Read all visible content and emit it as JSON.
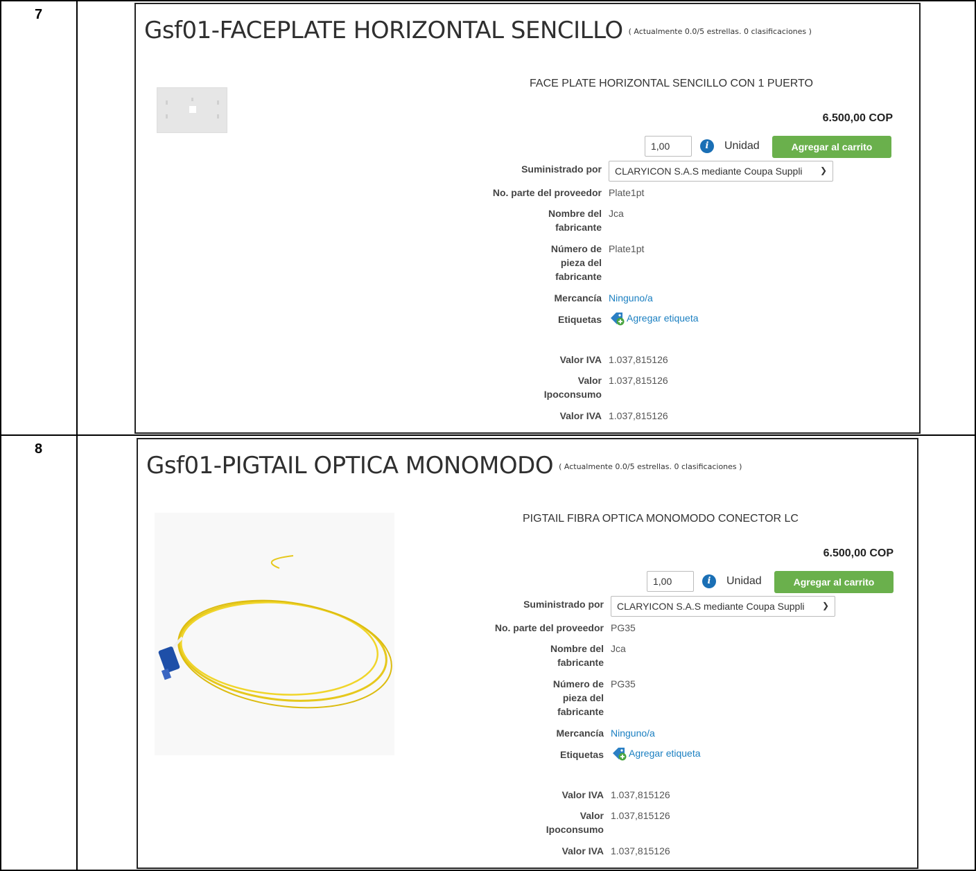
{
  "rows": [
    {
      "number": "7",
      "product": {
        "title": "Gsf01-FACEPLATE HORIZONTAL SENCILLO",
        "rating": "( Actualmente 0.0/5 estrellas. 0 clasificaciones )",
        "description": "FACE PLATE HORIZONTAL SENCILLO CON 1 PUERTO",
        "price": "6.500,00 COP",
        "quantity": "1,00",
        "unit": "Unidad",
        "add_to_cart": "Agregar al carrito",
        "supplied_by_label": "Suministrado por",
        "supplier": "CLARYICON S.A.S mediante Coupa Suppli",
        "supplier_part_label": "No. parte del proveedor",
        "supplier_part": "Plate1pt",
        "manufacturer_label_1": "Nombre del",
        "manufacturer_label_2": "fabricante",
        "manufacturer": "Jca",
        "mfr_part_label_1": "Número de",
        "mfr_part_label_2": "pieza del",
        "mfr_part_label_3": "fabricante",
        "mfr_part": "Plate1pt",
        "commodity_label": "Mercancía",
        "commodity": "Ninguno/a",
        "tags_label": "Etiquetas",
        "add_tag": "Agregar etiqueta",
        "iva_label": "Valor IVA",
        "iva": "1.037,815126",
        "ipoconsumo_label_1": "Valor",
        "ipoconsumo_label_2": "Ipoconsumo",
        "ipoconsumo": "1.037,815126",
        "iva2_label": "Valor IVA",
        "iva2": "1.037,815126"
      }
    },
    {
      "number": "8",
      "product": {
        "title": "Gsf01-PIGTAIL OPTICA MONOMODO",
        "rating": "( Actualmente 0.0/5 estrellas. 0 clasificaciones )",
        "description": "PIGTAIL FIBRA OPTICA MONOMODO CONECTOR LC",
        "price": "6.500,00 COP",
        "quantity": "1,00",
        "unit": "Unidad",
        "add_to_cart": "Agregar al carrito",
        "supplied_by_label": "Suministrado por",
        "supplier": "CLARYICON S.A.S mediante Coupa Suppli",
        "supplier_part_label": "No. parte del proveedor",
        "supplier_part": "PG35",
        "manufacturer_label_1": "Nombre del",
        "manufacturer_label_2": "fabricante",
        "manufacturer": "Jca",
        "mfr_part_label_1": "Número de",
        "mfr_part_label_2": "pieza del",
        "mfr_part_label_3": "fabricante",
        "mfr_part": "PG35",
        "commodity_label": "Mercancía",
        "commodity": "Ninguno/a",
        "tags_label": "Etiquetas",
        "add_tag": "Agregar etiqueta",
        "iva_label": "Valor IVA",
        "iva": "1.037,815126",
        "ipoconsumo_label_1": "Valor",
        "ipoconsumo_label_2": "Ipoconsumo",
        "ipoconsumo": "1.037,815126",
        "iva2_label": "Valor IVA",
        "iva2": "1.037,815126"
      }
    }
  ],
  "colors": {
    "button": "#6ab04c",
    "link": "#1a7fc1",
    "info": "#1a6fb5"
  }
}
